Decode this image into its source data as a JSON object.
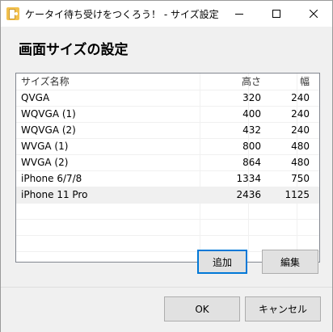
{
  "window": {
    "title": "ケータイ待ち受けをつくろう！ - サイズ設定"
  },
  "icons": {
    "app": "app-icon",
    "minimize": "minimize-icon",
    "maximize": "maximize-icon",
    "close": "close-icon"
  },
  "heading": "画面サイズの設定",
  "table": {
    "columns": [
      "サイズ名称",
      "高さ",
      "幅"
    ],
    "rows": [
      {
        "name": "QVGA",
        "height": "320",
        "width": "240"
      },
      {
        "name": "WQVGA (1)",
        "height": "400",
        "width": "240"
      },
      {
        "name": "WQVGA (2)",
        "height": "432",
        "width": "240"
      },
      {
        "name": "WVGA (1)",
        "height": "800",
        "width": "480"
      },
      {
        "name": "WVGA (2)",
        "height": "864",
        "width": "480"
      },
      {
        "name": "iPhone 6/7/8",
        "height": "1334",
        "width": "750"
      },
      {
        "name": "iPhone 11 Pro",
        "height": "2436",
        "width": "1125"
      }
    ],
    "selected_row": "iPhone 11 Pro"
  },
  "buttons": {
    "add": "追加",
    "edit": "編集",
    "ok": "OK",
    "cancel": "キャンセル"
  },
  "colors": {
    "accent": "#0078d7",
    "selected_row": "#f0f0f0"
  }
}
